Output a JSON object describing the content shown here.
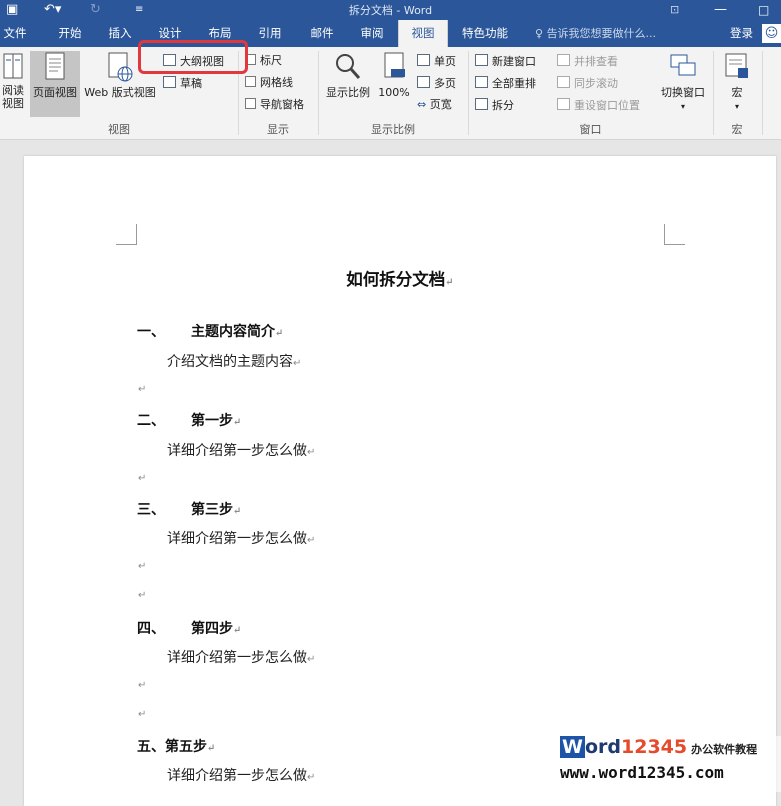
{
  "window": {
    "title": "拆分文档 - Word"
  },
  "tabs": [
    "文件",
    "开始",
    "插入",
    "设计",
    "布局",
    "引用",
    "邮件",
    "审阅",
    "视图",
    "特色功能"
  ],
  "active_tab": "视图",
  "tell_me": "告诉我您想要做什么...",
  "login": "登录",
  "ribbon": {
    "views": {
      "read": "阅读\n视图",
      "print": "页面视图",
      "web": "Web 版式视图",
      "outline": "大纲视图",
      "draft": "草稿",
      "label": "视图"
    },
    "show": {
      "ruler": "标尺",
      "gridlines": "网格线",
      "nav_pane": "导航窗格",
      "label": "显示"
    },
    "zoom": {
      "zoom": "显示比例",
      "pct100": "100%",
      "one_page": "单页",
      "multi_page": "多页",
      "page_width": "页宽",
      "label": "显示比例"
    },
    "window": {
      "new_window": "新建窗口",
      "arrange_all": "全部重排",
      "split": "拆分",
      "side_by_side": "并排查看",
      "sync_scroll": "同步滚动",
      "reset_pos": "重设窗口位置",
      "switch": "切换窗口",
      "label": "窗口"
    },
    "macros": {
      "macro": "宏",
      "label": "宏"
    }
  },
  "document": {
    "title": "如何拆分文档",
    "sections": [
      {
        "num": "一、",
        "heading": "主题内容简介",
        "body": "介绍文档的主题内容"
      },
      {
        "num": "二、",
        "heading": "第一步",
        "body": "详细介绍第一步怎么做"
      },
      {
        "num": "三、",
        "heading": "第三步",
        "body": "详细介绍第一步怎么做"
      },
      {
        "num": "四、",
        "heading": "第四步",
        "body": "详细介绍第一步怎么做"
      },
      {
        "num": "五、",
        "heading": "第五步",
        "body": "详细介绍第一步怎么做"
      }
    ],
    "para_mark": "↵"
  },
  "watermark": {
    "logo_w": "W",
    "logo_rest": "ord",
    "logo_digits": "12345",
    "sub": "办公软件教程",
    "url": "www.word12345.com"
  },
  "colors": {
    "accent": "#2b579a",
    "highlight": "#e0383e"
  }
}
